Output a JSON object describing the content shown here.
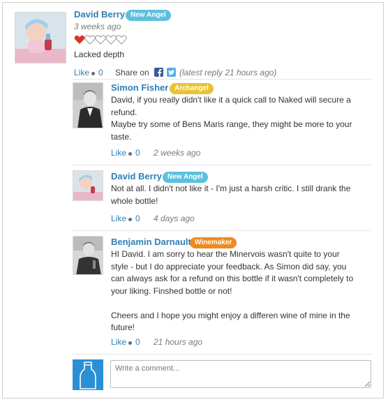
{
  "review": {
    "author": "David Berry",
    "badge": "New Angel",
    "time": "3 weeks ago",
    "rating": 1,
    "rating_max": 5,
    "text": "Lacked depth",
    "like_label": "Like",
    "like_count": "0",
    "share_label": "Share on",
    "latest_reply": "(latest reply 21 hours ago)"
  },
  "replies": [
    {
      "author": "Simon Fisher",
      "badge": "Archangel",
      "lines": [
        "David, if you really didn't like it a quick call to Naked will secure a",
        "refund.",
        "Maybe try some of Bens Maris range, they might be more to your",
        "taste."
      ],
      "like_label": "Like",
      "like_count": "0",
      "time": "2 weeks ago"
    },
    {
      "author": "David Berry",
      "badge": "New Angel",
      "lines": [
        "Not at all. I didn't not like it - I'm just a harsh critic. I still drank the",
        "whole bottle!"
      ],
      "like_label": "Like",
      "like_count": "0",
      "time": "4 days ago"
    },
    {
      "author": "Benjamin Darnault",
      "badge": "Winemaker",
      "lines": [
        "HI David. I am sorry to hear the Minervois wasn't quite to your",
        "style - but I do appreciate your feedback. As Simon did say, you",
        "can always ask for a refund on this bottle if it wasn't completely to",
        "your liking. Finshed bottle or not!",
        "",
        "Cheers and I hope you might enjoy a differen wine of mine in the",
        "future!"
      ],
      "like_label": "Like",
      "like_count": "0",
      "time": "21 hours ago"
    }
  ],
  "comment": {
    "placeholder": "Write a comment..."
  },
  "colors": {
    "link": "#2f7fb6",
    "new_angel": "#5bc0de",
    "archangel": "#e9c233",
    "winemaker": "#ee8a22",
    "heart": "#d9342b",
    "facebook": "#3b5998",
    "twitter": "#55acee",
    "comment_icon_bg": "#2b8fd6"
  }
}
